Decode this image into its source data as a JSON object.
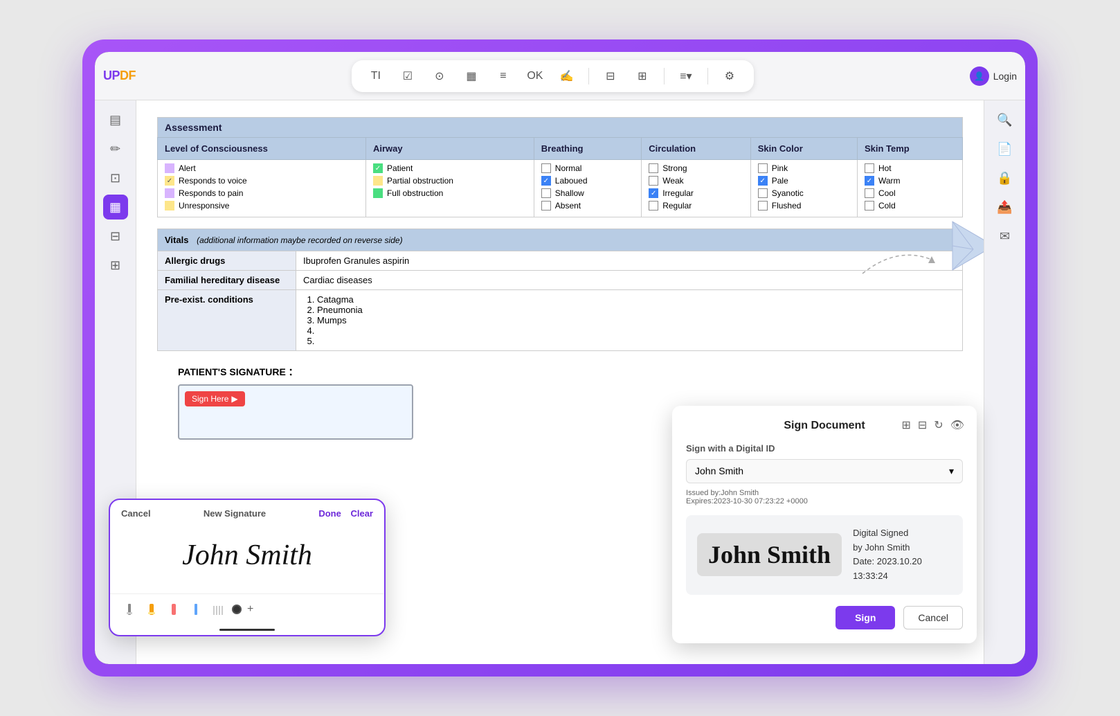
{
  "app": {
    "name": "UPDF",
    "name_highlight": "PDF",
    "login_label": "Login"
  },
  "toolbar": {
    "icons": [
      "TI",
      "✓",
      "⬤",
      "▦",
      "▤",
      "OK",
      "✍",
      "|",
      "▦",
      "⊞",
      "|",
      "≡▾",
      "|",
      "⚙"
    ]
  },
  "sidebar_left": {
    "icons": [
      "▤",
      "—",
      "✏",
      "—",
      "⊡",
      "—",
      "⊟",
      "⊞"
    ]
  },
  "sidebar_right": {
    "icons": [
      "🔍",
      "—",
      "📄",
      "🔒",
      "📤",
      "✉"
    ]
  },
  "document": {
    "assessment_section": "Assessment",
    "assessment_columns": [
      "Level of Consciousness",
      "Airway",
      "Breathing",
      "Circulation",
      "Skin Color",
      "Skin Temp"
    ],
    "level_of_consciousness": {
      "items": [
        {
          "label": "Alert",
          "checked": false,
          "color": "purple"
        },
        {
          "label": "Responds to voice",
          "checked": true,
          "color": "yellow"
        },
        {
          "label": "Responds to pain",
          "checked": false,
          "color": "purple"
        },
        {
          "label": "Unresponsive",
          "checked": false,
          "color": "yellow"
        }
      ]
    },
    "airway": {
      "items": [
        {
          "label": "Patient",
          "checked": true,
          "color": "green"
        },
        {
          "label": "Partial obstruction",
          "checked": false,
          "color": "yellow"
        },
        {
          "label": "Full obstruction",
          "checked": false,
          "color": "green"
        }
      ]
    },
    "breathing": {
      "items": [
        {
          "label": "Normal",
          "checked": false
        },
        {
          "label": "Laboued",
          "checked": true
        },
        {
          "label": "Shallow",
          "checked": false
        },
        {
          "label": "Absent",
          "checked": false
        }
      ]
    },
    "circulation": {
      "items": [
        {
          "label": "Strong",
          "checked": false
        },
        {
          "label": "Weak",
          "checked": false
        },
        {
          "label": "Irregular",
          "checked": true
        },
        {
          "label": "Regular",
          "checked": false
        }
      ]
    },
    "skin_color": {
      "items": [
        {
          "label": "Pink",
          "checked": false
        },
        {
          "label": "Pale",
          "checked": true
        },
        {
          "label": "Syanotic",
          "checked": false
        },
        {
          "label": "Flushed",
          "checked": false
        }
      ]
    },
    "skin_temp": {
      "items": [
        {
          "label": "Hot",
          "checked": false
        },
        {
          "label": "Warm",
          "checked": true
        },
        {
          "label": "Cool",
          "checked": false
        },
        {
          "label": "Cold",
          "checked": false
        }
      ]
    },
    "vitals_label": "Vitals",
    "vitals_note": "(additional information maybe recorded on reverse side)",
    "vitals_rows": [
      {
        "label": "Allergic drugs",
        "value": "Ibuprofen Granules  aspirin"
      },
      {
        "label": "Familial hereditary disease",
        "value": "Cardiac diseases"
      },
      {
        "label": "Pre-exist. conditions",
        "items": [
          "Catagma",
          "Pneumonia",
          "Mumps",
          "",
          ""
        ]
      }
    ],
    "patient_signature_label": "PATIENT'S SIGNATURE ：",
    "sign_here_btn": "Sign Here"
  },
  "signature_panel": {
    "cancel_label": "Cancel",
    "title": "New Signature",
    "done_label": "Done",
    "clear_label": "Clear",
    "signature_text": "John Smith"
  },
  "sign_document_panel": {
    "title": "Sign Document",
    "sign_with_label": "Sign with a Digital ID",
    "digital_id": "John Smith",
    "issued_by": "Issued by:John Smith",
    "expires": "Expires:2023-10-30 07:23:22 +0000",
    "ds_name": "John Smith",
    "ds_title": "Digital Signed",
    "ds_by": "by John Smith",
    "ds_date_label": "Date: 2023.10.20",
    "ds_time": "13:33:24",
    "sign_btn": "Sign",
    "cancel_btn": "Cancel"
  }
}
